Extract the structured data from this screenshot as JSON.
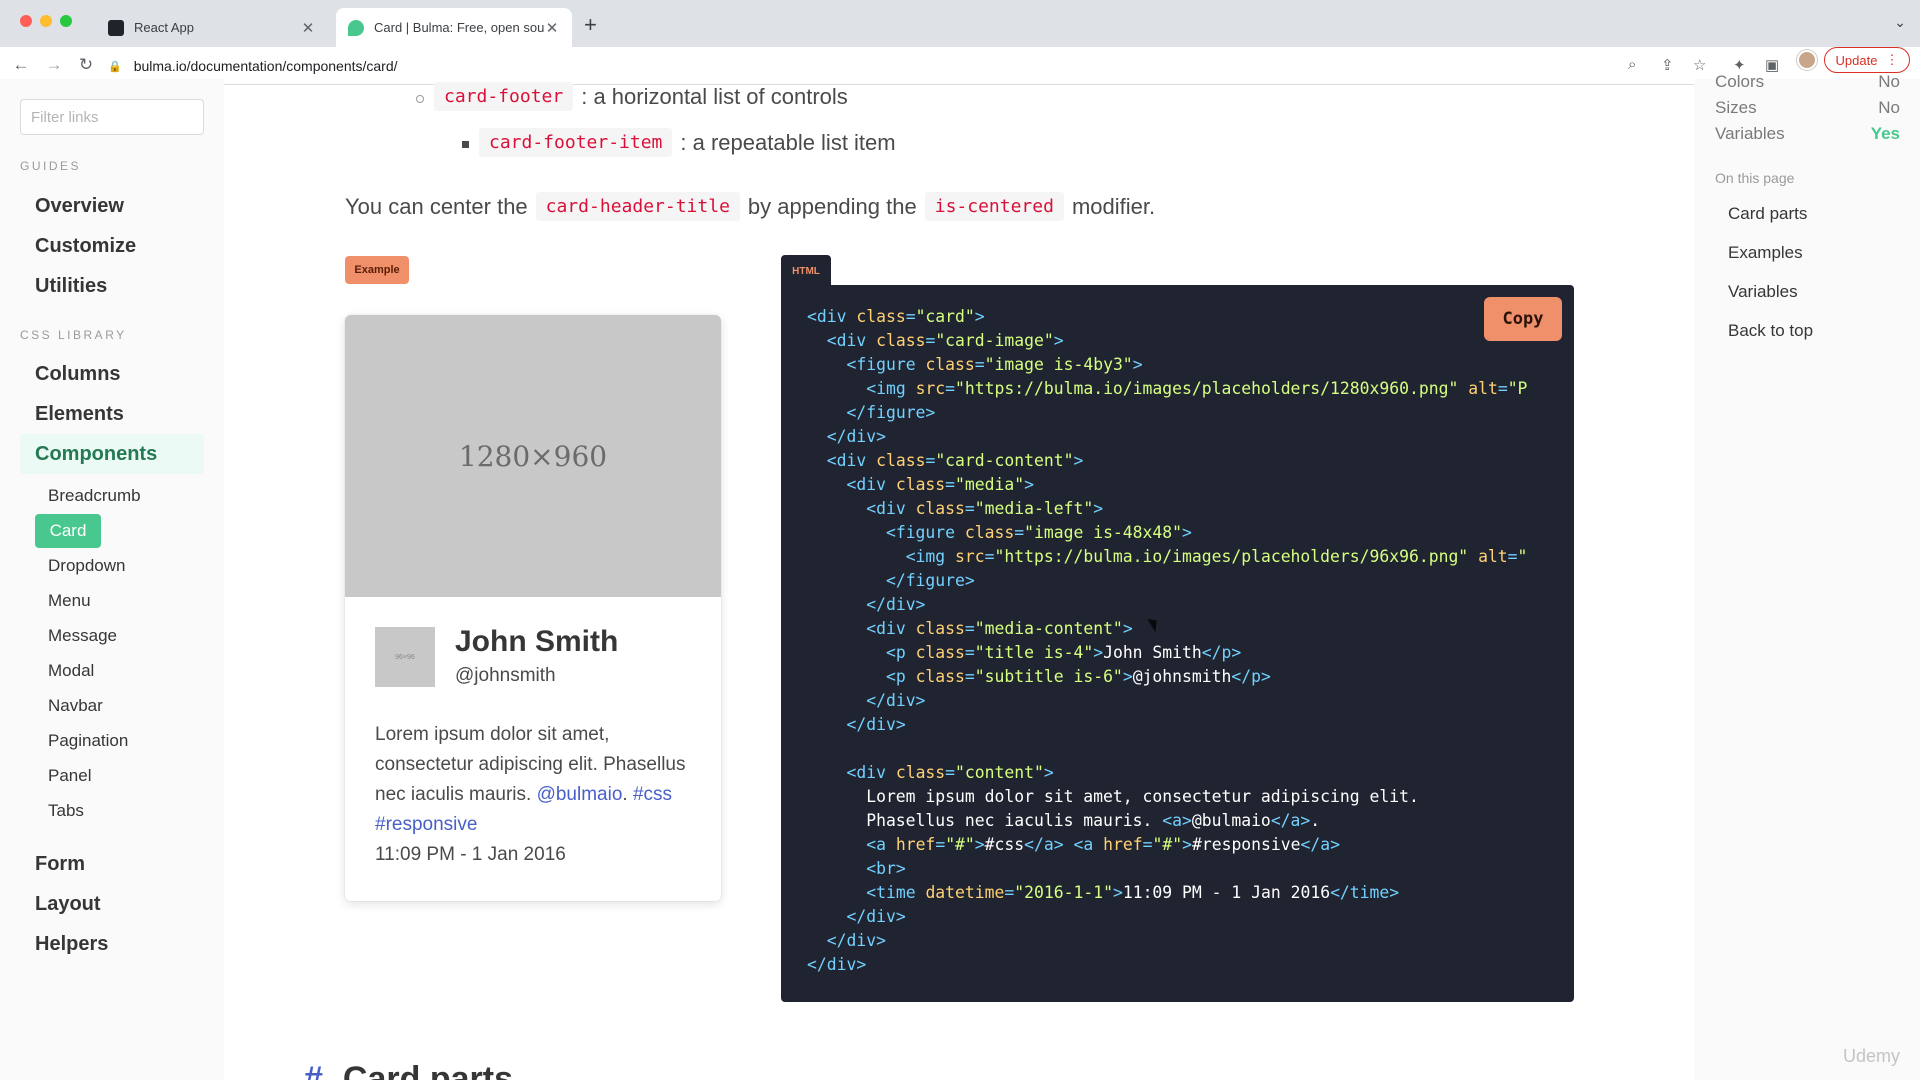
{
  "browser": {
    "tabs": [
      {
        "title": "React App"
      },
      {
        "title": "Card | Bulma: Free, open source"
      }
    ],
    "url": "bulma.io/documentation/components/card/",
    "update_label": "Update"
  },
  "sidebar": {
    "filter_placeholder": "Filter links",
    "guides_label": "GUIDES",
    "guides": [
      "Overview",
      "Customize",
      "Utilities"
    ],
    "library_label": "CSS LIBRARY",
    "library": [
      "Columns",
      "Elements",
      "Components"
    ],
    "components": [
      "Breadcrumb",
      "Card",
      "Dropdown",
      "Menu",
      "Message",
      "Modal",
      "Navbar",
      "Pagination",
      "Panel",
      "Tabs"
    ],
    "more": [
      "Form",
      "Layout",
      "Helpers"
    ]
  },
  "main": {
    "list": [
      {
        "code": "card-footer",
        "text": ": a horizontal list of controls"
      },
      {
        "code": "card-footer-item",
        "text": ": a repeatable list item"
      }
    ],
    "center_sentence": {
      "part1": "You can center the",
      "code1": "card-header-title",
      "part2": "by appending the",
      "code2": "is-centered",
      "part3": "modifier."
    },
    "example_tag": "Example",
    "html_tab": "HTML",
    "copy_label": "Copy",
    "next_heading_hash": "#",
    "next_heading": "Card parts"
  },
  "demo_card": {
    "image_label": "1280×960",
    "thumb_label": "96×96",
    "title": "John Smith",
    "subtitle": "@johnsmith",
    "content_line1": "Lorem ipsum dolor sit amet, consectetur adipiscing elit. Phasellus nec iaculis mauris.",
    "link1": "@bulmaio",
    "link2": "#css",
    "link3": "#responsive",
    "time": "11:09 PM - 1 Jan 2016"
  },
  "right_panel": {
    "specs": [
      {
        "label": "Colors",
        "value": "No"
      },
      {
        "label": "Sizes",
        "value": "No"
      },
      {
        "label": "Variables",
        "value": "Yes"
      }
    ],
    "on_this_page": "On this page",
    "toc": [
      "Card parts",
      "Examples",
      "Variables",
      "Back to top"
    ]
  },
  "watermark": "Udemy",
  "colors": {
    "bulma_green": "#48c78e",
    "code_bg": "#1f2430",
    "accent_orange": "#f0906a",
    "inline_code_red": "#da1039"
  }
}
